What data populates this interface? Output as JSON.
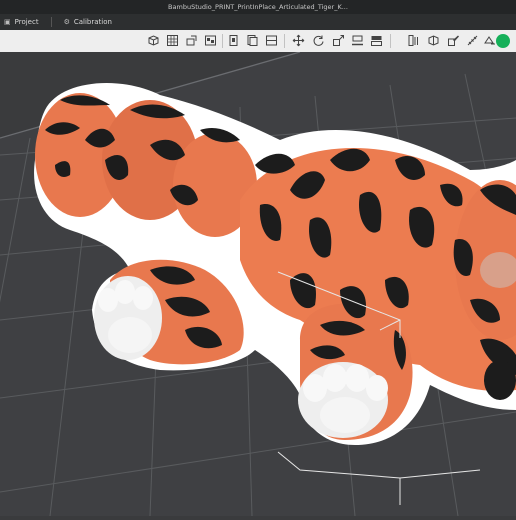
{
  "window": {
    "title": "BambuStudio_PRINT_PrintInPlace_Articulated_Tiger_K..."
  },
  "tabs": [
    {
      "label": "Project",
      "icon": "cube-icon"
    },
    {
      "label": "Calibration",
      "icon": "gear-icon"
    }
  ],
  "toolbar": {
    "buttons": [
      "add-object-icon",
      "grid-icon",
      "orient-icon",
      "arrange-icon",
      "plate-icon",
      "plate-copy-icon",
      "split-icon",
      "move-icon",
      "rotate-icon",
      "scale-icon",
      "lay-flat-icon",
      "cut-icon",
      "support-paint-icon",
      "seam-paint-icon",
      "color-paint-icon",
      "measure-icon",
      "assembly-icon"
    ]
  },
  "colors": {
    "bed": "#3a3b3d",
    "grid": "#5b5d60",
    "tiger_orange": "#e8784e",
    "tiger_stripe": "#1c1c1c",
    "paw_white": "#eeeeee",
    "outline": "#ffffff",
    "accent": "#16b05a"
  }
}
